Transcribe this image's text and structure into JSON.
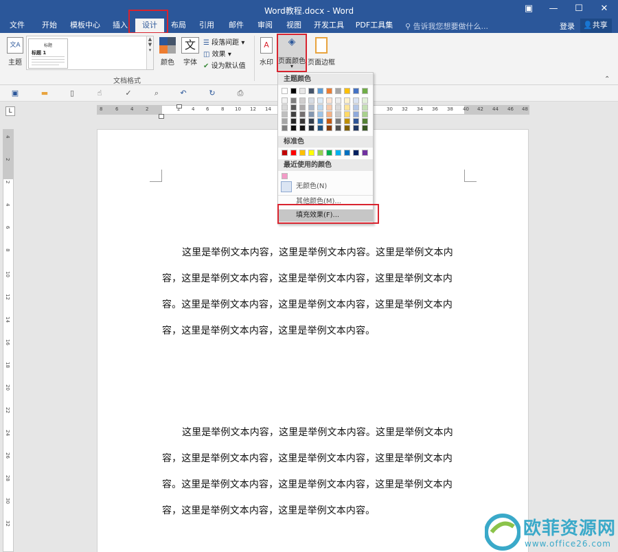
{
  "window": {
    "title": "Word教程.docx - Word",
    "controls": [
      "▣",
      "—",
      "☐",
      "✕"
    ]
  },
  "tabs": [
    "文件",
    "开始",
    "模板中心",
    "插入",
    "设计",
    "布局",
    "引用",
    "邮件",
    "审阅",
    "视图",
    "开发工具",
    "PDF工具集"
  ],
  "active_tab": "设计",
  "tell_me": "告诉我您想要做什么...",
  "login": "登录",
  "share": "共享",
  "ribbon": {
    "theme_label": "主题",
    "gallery_item_title": "标题",
    "gallery_item_heading": "标题 1",
    "colors_label": "颜色",
    "fonts_label": "字体",
    "para_spacing_label": "段落间距",
    "effects_label": "效果",
    "set_default_label": "设为默认值",
    "group_label": "文档格式",
    "watermark_label": "水印",
    "page_color_label": "页面颜色",
    "page_border_label": "页面边框"
  },
  "ruler_ticks": [
    "8",
    "6",
    "4",
    "2",
    "2",
    "4",
    "6",
    "8",
    "10",
    "12",
    "14",
    "30",
    "32",
    "34",
    "36",
    "38",
    "40",
    "42",
    "44",
    "46",
    "48"
  ],
  "vruler_ticks": [
    "4",
    "2",
    "2",
    "4",
    "6",
    "8",
    "10",
    "12",
    "14",
    "16",
    "18",
    "20",
    "22",
    "24",
    "26",
    "28",
    "30",
    "32"
  ],
  "document": {
    "paragraphs": [
      "这里是举例文本内容，这里是举例文本内容。这里是举例文本内容，这里是举例文本内容，这里是举例文本内容，这里是举例文本内容。这里是举例文本内容，这里是举例文本内容，这里是举例文本内容，这里是举例文本内容，这里是举例文本内容。",
      "这里是举例文本内容，这里是举例文本内容。这里是举例文本内容，这里是举例文本内容，这里是举例文本内容，这里是举例文本内容。这里是举例文本内容，这里是举例文本内容，这里是举例文本内容，这里是举例文本内容，这里是举例文本内容。"
    ]
  },
  "dropdown": {
    "theme_colors_label": "主题颜色",
    "standard_colors_label": "标准色",
    "recent_colors_label": "最近使用的颜色",
    "no_color": "无颜色(N)",
    "more_colors": "其他颜色(M)...",
    "fill_effects": "填充效果(F)...",
    "theme_top_row": [
      "#ffffff",
      "#000000",
      "#e7e6e6",
      "#44546a",
      "#5b9bd5",
      "#ed7d31",
      "#a5a5a5",
      "#ffc000",
      "#4472c4",
      "#70ad47"
    ],
    "theme_shades": [
      [
        "#f2f2f2",
        "#d9d9d9",
        "#bfbfbf",
        "#a6a6a6",
        "#808080"
      ],
      [
        "#7f7f7f",
        "#595959",
        "#404040",
        "#262626",
        "#0d0d0d"
      ],
      [
        "#d0cece",
        "#aeabab",
        "#757070",
        "#3a3838",
        "#171616"
      ],
      [
        "#d6dce4",
        "#adb9ca",
        "#8497b0",
        "#333f4f",
        "#222a35"
      ],
      [
        "#deebf7",
        "#bdd7ee",
        "#9dc3e6",
        "#2e75b6",
        "#1f4e79"
      ],
      [
        "#fbe5d6",
        "#f8cbad",
        "#f4b183",
        "#c55a11",
        "#843c0c"
      ],
      [
        "#ededed",
        "#dbdbdb",
        "#c9c9c9",
        "#7b7b7b",
        "#525252"
      ],
      [
        "#fff2cc",
        "#ffe699",
        "#ffd966",
        "#bf9000",
        "#7f6000"
      ],
      [
        "#dae3f3",
        "#b4c7e7",
        "#8faadc",
        "#2f5597",
        "#203864"
      ],
      [
        "#e2f0d9",
        "#c5e0b4",
        "#a9d18e",
        "#548235",
        "#385723"
      ]
    ],
    "standard_colors": [
      "#c00000",
      "#ff0000",
      "#ffc000",
      "#ffff00",
      "#92d050",
      "#00b050",
      "#00b0f0",
      "#0070c0",
      "#002060",
      "#7030a0"
    ],
    "recent_colors": [
      "#f39bc7"
    ]
  },
  "watermark_logo": {
    "name": "欧菲资源网",
    "url": "www.office26.com"
  }
}
